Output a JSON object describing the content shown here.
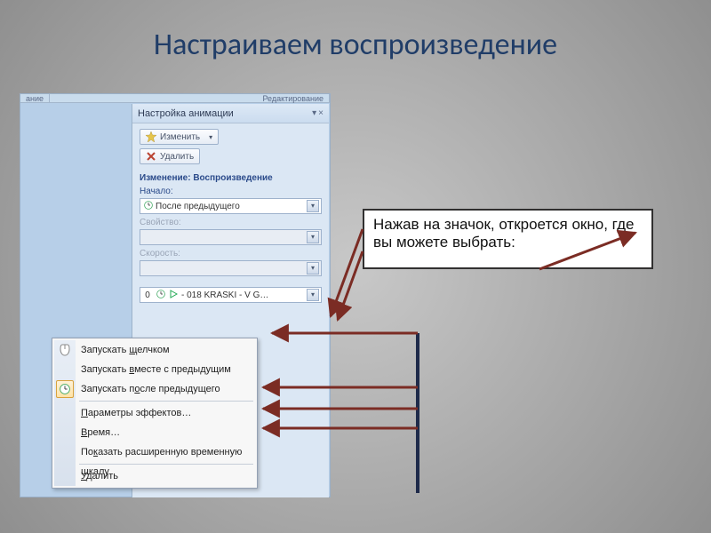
{
  "slide": {
    "title": "Настраиваем воспроизведение"
  },
  "ribbon": {
    "tab_left": "ание",
    "tab_right": "Редактирование"
  },
  "pane": {
    "title": "Настройка анимации",
    "btn_change": "Изменить",
    "btn_delete": "Удалить",
    "section": "Изменение: Воспроизведение",
    "field_start": "Начало:",
    "start_value": "После предыдущего",
    "field_property": "Свойство:",
    "field_speed": "Скорость:",
    "anim_index": "0",
    "anim_text": "- 018 KRASKI - V G…"
  },
  "context_menu": {
    "items": [
      "Запускать щелчком",
      "Запускать вместе с предыдущим",
      "Запускать после предыдущего",
      "Параметры эффектов…",
      "Время…",
      "Показать расширенную временную шкалу",
      "Удалить"
    ]
  },
  "callout": {
    "text": "Нажав на значок, откроется окно, где вы можете выбрать:"
  },
  "colors": {
    "accent": "#203d68",
    "arrow": "#7b2c24"
  }
}
